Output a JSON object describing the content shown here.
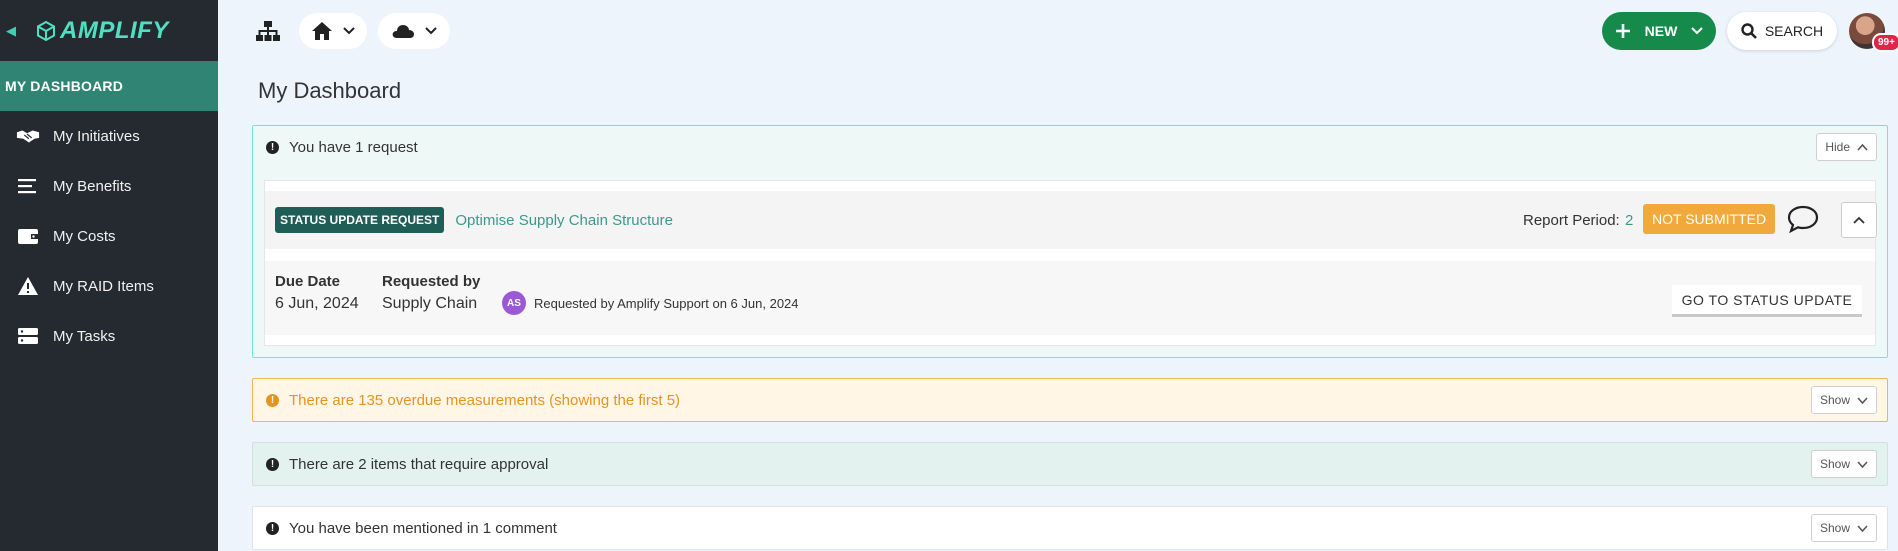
{
  "brand": {
    "name": "AMPLIFY"
  },
  "sidebar": {
    "header": "MY DASHBOARD",
    "items": [
      {
        "label": "My Initiatives",
        "icon": "handshake-icon"
      },
      {
        "label": "My Benefits",
        "icon": "list-lines-icon"
      },
      {
        "label": "My Costs",
        "icon": "wallet-icon"
      },
      {
        "label": "My RAID Items",
        "icon": "warning-icon"
      },
      {
        "label": "My Tasks",
        "icon": "server-stack-icon"
      }
    ]
  },
  "topbar": {
    "new_label": "NEW",
    "search_label": "SEARCH",
    "notification_count": "99+"
  },
  "page": {
    "title": "My Dashboard"
  },
  "panels": {
    "requests": {
      "message": "You have 1 request",
      "toggle": "Hide",
      "card": {
        "tag": "STATUS UPDATE REQUEST",
        "initiative": "Optimise Supply Chain Structure",
        "report_period_label": "Report Period:",
        "report_period_value": "2",
        "status": "NOT SUBMITTED",
        "due_label": "Due Date",
        "due_value": "6 Jun, 2024",
        "requested_by_label": "Requested by",
        "requested_by_value": "Supply Chain",
        "avatar_initials": "AS",
        "requested_note": "Requested by Amplify Support on 6 Jun, 2024",
        "goto_label": "GO TO STATUS UPDATE"
      }
    },
    "overdue": {
      "message": "There are 135 overdue measurements (showing the first 5)",
      "toggle": "Show"
    },
    "approval": {
      "message": "There are 2 items that require approval",
      "toggle": "Show"
    },
    "mentions": {
      "message": "You have been mentioned in 1 comment",
      "toggle": "Show"
    }
  },
  "colors": {
    "sidebar_bg": "#242a30",
    "sidebar_active": "#2f8474",
    "brand_accent": "#4fe0c2",
    "new_button": "#168a4a",
    "status_orange": "#f2a93b",
    "request_tag": "#1f5e57"
  }
}
